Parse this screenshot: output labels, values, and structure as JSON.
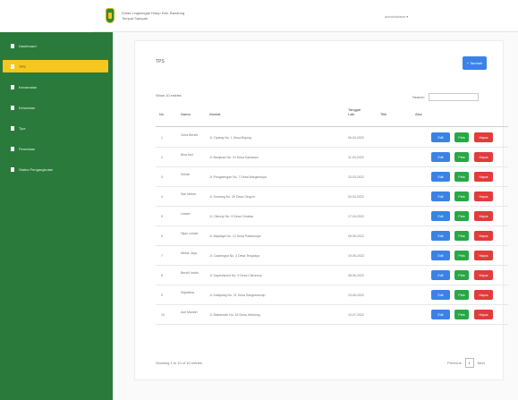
{
  "header": {
    "brand_line1": "Dinas Lingkungan Hidup Kab. Bandung",
    "brand_line2": "Tempat Sampah",
    "user": "administrator ▾"
  },
  "sidebar": {
    "items": [
      {
        "label": "Dashboard",
        "active": false
      },
      {
        "label": "TPS",
        "active": true
      },
      {
        "label": "Kecamatan",
        "active": false
      },
      {
        "label": "Kelurahan",
        "active": false
      },
      {
        "label": "Tipe",
        "active": false
      },
      {
        "label": "Pemetaan",
        "active": false
      },
      {
        "label": "Status Pengangkutan",
        "active": false
      }
    ]
  },
  "main": {
    "title": "TPS",
    "add_button": "+ Tambah",
    "length_label": "Show 10 entries",
    "search_label": "Search:",
    "search_placeholder": "",
    "columns": [
      "No",
      "Nama",
      "Alamat",
      "Tanggal Laik",
      "Titik",
      "Aksi"
    ],
    "rows": [
      {
        "no": "1",
        "nama": "Cinta Bersih",
        "alamat": "Jl. Ciparay No. 1 Desa Bojong",
        "tanggal": "06-03-2022",
        "titik": ""
      },
      {
        "no": "2",
        "nama": "Bina Asri",
        "alamat": "Jl. Banjaran No. 24 Desa Kamasan",
        "tanggal": "11-03-2022",
        "titik": ""
      },
      {
        "no": "3",
        "nama": "Sehati",
        "alamat": "Jl. Pangalengan No. 7 Desa Margamulya",
        "tanggal": "20-03-2022",
        "titik": ""
      },
      {
        "no": "4",
        "nama": "Sari Mekar",
        "alamat": "Jl. Soreang No. 30 Desa Cingcin",
        "tanggal": "02-04-2022",
        "titik": ""
      },
      {
        "no": "5",
        "nama": "Lestari",
        "alamat": "Jl. Cileunyi No. 5 Desa Cimekar",
        "tanggal": "17-04-2022",
        "titik": ""
      },
      {
        "no": "6",
        "nama": "Hijau Lestari",
        "alamat": "Jl. Majalaya No. 12 Desa Padamulya",
        "tanggal": "05-05-2022",
        "titik": ""
      },
      {
        "no": "7",
        "nama": "Mekar Jaya",
        "alamat": "Jl. Cicalengka No. 3 Desa Tenjolaya",
        "tanggal": "19-05-2022",
        "titik": ""
      },
      {
        "no": "8",
        "nama": "Bersih Indah",
        "alamat": "Jl. Dayeuhkolot No. 9 Desa Citeureup",
        "tanggal": "08-06-2022",
        "titik": ""
      },
      {
        "no": "9",
        "nama": "Sejahtera",
        "alamat": "Jl. Katapang No. 21 Desa Sangkanhurip",
        "tanggal": "23-06-2022",
        "titik": ""
      },
      {
        "no": "10",
        "nama": "Asri Mandiri",
        "alamat": "Jl. Baleendah No. 15 Desa Jelekong",
        "tanggal": "10-07-2022",
        "titik": ""
      }
    ],
    "actions": {
      "edit": "Edit",
      "map": "Peta",
      "delete": "Hapus"
    },
    "info": "Showing 1 to 10 of 10 entries",
    "pager": {
      "prev": "Previous",
      "current": "1",
      "next": "Next"
    }
  },
  "colors": {
    "sidebar_bg": "#2a7a3b",
    "sidebar_active": "#f6c71f",
    "primary": "#3b82e6",
    "success": "#28a745",
    "danger": "#e03c3c"
  }
}
